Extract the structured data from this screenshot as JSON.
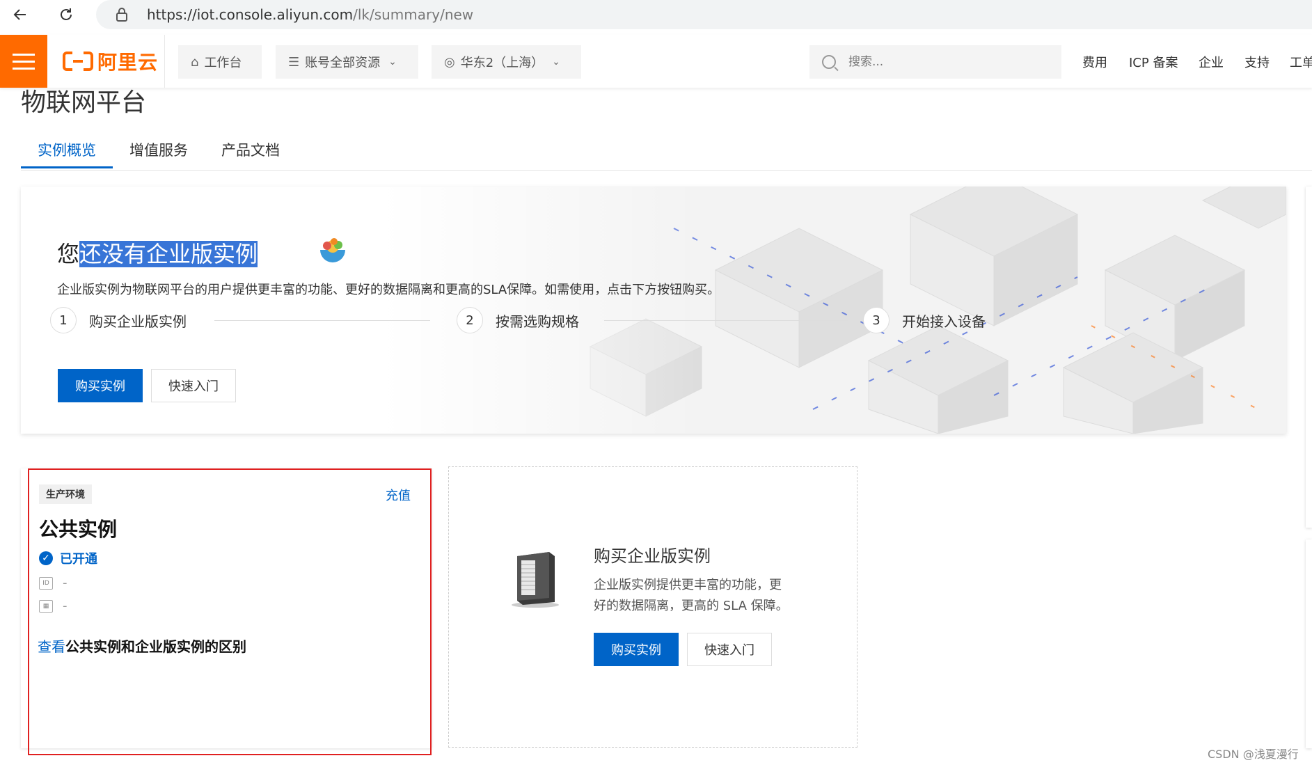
{
  "browser": {
    "url_host": "https://iot.console.aliyun.com",
    "url_path": "/lk/summary/new"
  },
  "header": {
    "logo_text": "阿里云",
    "workbench": "工作台",
    "resources": "账号全部资源",
    "region": "华东2（上海）",
    "search_placeholder": "搜索...",
    "links": [
      "费用",
      "ICP 备案",
      "企业",
      "支持",
      "工单"
    ]
  },
  "page": {
    "title": "物联网平台",
    "tabs": [
      "实例概览",
      "增值服务",
      "产品文档"
    ]
  },
  "banner": {
    "title_prefix": "您",
    "title_highlight": "还没有企业版实例",
    "description": "企业版实例为物联网平台的用户提供更丰富的功能、更好的数据隔离和更高的SLA保障。如需使用，点击下方按钮购买。",
    "steps": [
      {
        "num": "1",
        "label": "购买企业版实例"
      },
      {
        "num": "2",
        "label": "按需选购规格"
      },
      {
        "num": "3",
        "label": "开始接入设备"
      }
    ],
    "buy_button": "购买实例",
    "quickstart_button": "快速入门"
  },
  "public_instance_card": {
    "env_tag": "生产环境",
    "recharge": "充值",
    "title": "公共实例",
    "status": "已开通",
    "id_value": "-",
    "date_value": "-",
    "link_prefix": "查看",
    "link_text": "公共实例和企业版实例的区别"
  },
  "enterprise_card": {
    "title": "购买企业版实例",
    "desc_line1": "企业版实例提供更丰富的功能，更",
    "desc_line2": "好的数据隔离，更高的 SLA 保障。",
    "buy_button": "购买实例",
    "quickstart_button": "快速入门"
  },
  "watermark": "CSDN @浅夏漫行",
  "colors": {
    "brand_orange": "#ff6a00",
    "primary_blue": "#0064c8",
    "highlight_red": "#e02020"
  }
}
